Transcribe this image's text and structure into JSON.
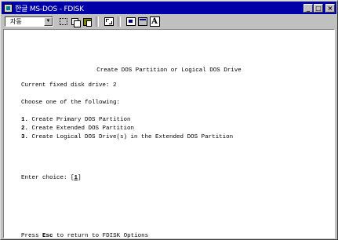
{
  "window": {
    "title": "한글 MS-DOS - FDISK",
    "minimize_glyph": "_",
    "maximize_glyph": "□",
    "close_glyph": "×"
  },
  "toolbar": {
    "font_combo_value": "자동",
    "combo_arrow_glyph": "▼",
    "font_button_label": "A",
    "icons": [
      "mark-icon",
      "copy-icon",
      "paste-icon",
      "full-screen-icon",
      "properties-icon",
      "background-icon",
      "font-icon"
    ]
  },
  "console": {
    "heading": "Create DOS Partition or Logical DOS Drive",
    "drive_label": "Current fixed disk drive:",
    "drive_value": "2",
    "choose_prompt": "Choose one of the following:",
    "options": [
      {
        "num": "1.",
        "label": "Create Primary DOS Partition"
      },
      {
        "num": "2.",
        "label": "Create Extended DOS Partition"
      },
      {
        "num": "3.",
        "label": "Create Logical DOS Drive(s) in the Extended DOS Partition"
      }
    ],
    "enter_label": "Enter choice:",
    "enter_open": "[",
    "enter_value": "1",
    "enter_close": "]",
    "esc_press": "Press",
    "esc_key": "Esc",
    "esc_rest": "to return to FDISK Options"
  },
  "colors": {
    "title_bar": "#0000a8",
    "window_chrome": "#c0c0c0",
    "console_background": "#ffffff",
    "console_text": "#000000"
  }
}
